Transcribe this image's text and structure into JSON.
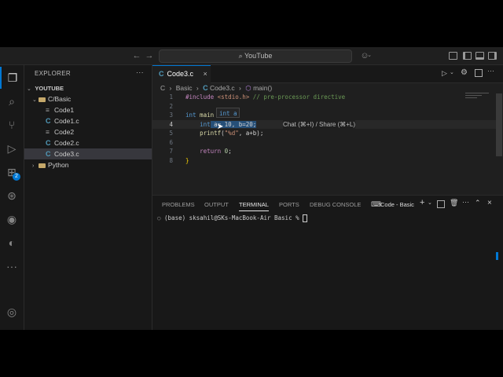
{
  "titlebar": {
    "search_label": "YouTube"
  },
  "activity": {
    "extensions_badge": "2"
  },
  "sidebar": {
    "title": "EXPLORER",
    "more": "···",
    "workspace": "YOUTUBE",
    "folder": "C/Basic",
    "files": [
      {
        "name": "Code1",
        "type": "text"
      },
      {
        "name": "Code1.c",
        "type": "c"
      },
      {
        "name": "Code2",
        "type": "text"
      },
      {
        "name": "Code2.c",
        "type": "c"
      },
      {
        "name": "Code3.c",
        "type": "c",
        "selected": true
      }
    ],
    "folder2": "Python"
  },
  "editor": {
    "tab_label": "Code3.c",
    "breadcrumb": {
      "c_icon": "C",
      "seg1": "Basic",
      "seg2": "Code3.c",
      "seg3": "main()"
    },
    "lines": {
      "l1": {
        "num": "1",
        "a": "#include",
        "b": " <stdio.h>",
        "c": " // pre-processor directive"
      },
      "l2": {
        "num": "2"
      },
      "l3": {
        "num": "3",
        "a": "int",
        "b": " main"
      },
      "l4": {
        "num": "4",
        "a": "int",
        "b": " a",
        "c": "= 10, b=20;"
      },
      "l5": {
        "num": "5",
        "a": "printf",
        "b": "(",
        "c": "\"%d\"",
        "d": ", a+b);"
      },
      "l6": {
        "num": "6"
      },
      "l7": {
        "num": "7",
        "a": "return",
        "b": " 0",
        "c": ";"
      },
      "l8": {
        "num": "8",
        "a": "}"
      }
    },
    "hover_text": "int a",
    "chat_hint": "Chat (⌘+I) / Share (⌘+L)"
  },
  "panel": {
    "tabs": [
      "PROBLEMS",
      "OUTPUT",
      "TERMINAL",
      "PORTS",
      "DEBUG CONSOLE"
    ],
    "terminal_name": "Code - Basic",
    "prompt": "(base) sksahil@SKs-MacBook-Air Basic % "
  },
  "colors": {
    "accent": "#0078d4",
    "background": "#1f1f1f",
    "selection": "#264f78"
  }
}
